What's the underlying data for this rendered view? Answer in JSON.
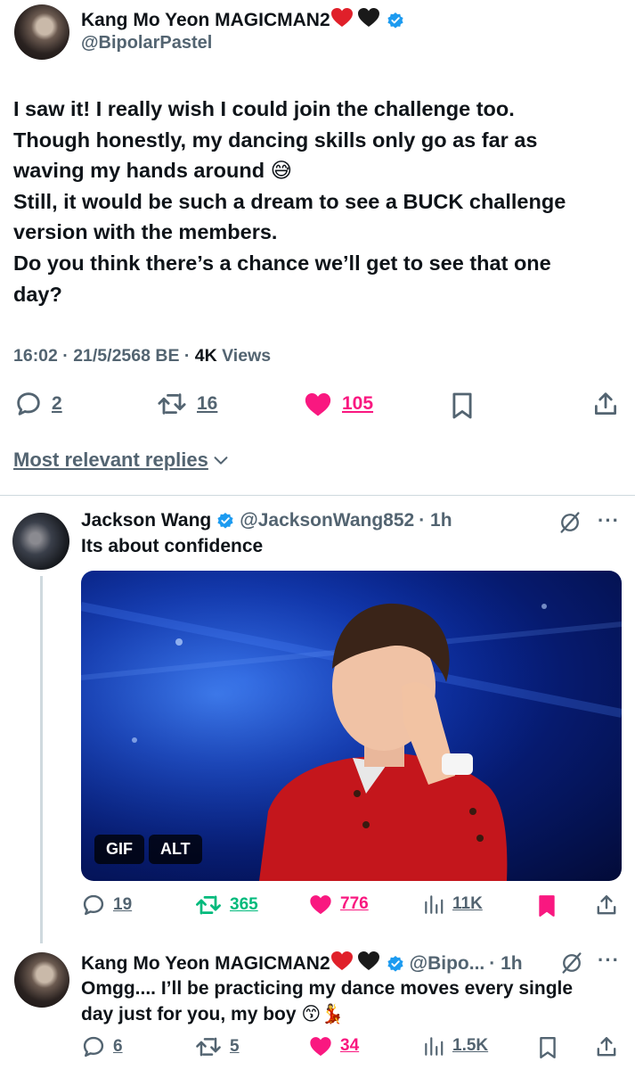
{
  "main_tweet": {
    "display_name": "Kang Mo Yeon MAGICMAN2",
    "handle": "@BipolarPastel",
    "lines": [
      "I saw it! I really wish I could join the challenge too.",
      "Though honestly, my dancing skills only go as far as",
      "waving my hands around",
      "Still, it would be such a dream to see a BUCK challenge",
      "version with the members.",
      "Do you think there’s a chance we’ll get to see that one",
      "day?"
    ],
    "emoji": "😅",
    "time": "16:02 · 21/5/2568 BE · ",
    "views_count": "4K",
    "views_label": "Views",
    "replies": "2",
    "reposts": "16",
    "likes": "105"
  },
  "sort_label": "Most relevant replies",
  "reply1": {
    "display_name": "Jackson Wang",
    "handle": "@JacksonWang852",
    "time": "· 1h",
    "text": "Its about confidence",
    "media_badges": [
      "GIF",
      "ALT"
    ],
    "replies": "19",
    "reposts": "365",
    "likes": "776",
    "views": "11K"
  },
  "reply2": {
    "display_name": "Kang Mo Yeon MAGICMAN2",
    "handle": "@Bipo...",
    "time": "· 1h",
    "line1": "Omgg.... I’ll be practicing my dance moves every single",
    "line2": "day just for you, my boy",
    "emoji": "😙💃",
    "replies": "6",
    "reposts": "5",
    "likes": "34",
    "views": "1.5K"
  },
  "colors": {
    "like_pink": "#f91880",
    "repost_green": "#00ba7c",
    "verified_blue": "#1d9bf0",
    "muted": "#536471"
  }
}
